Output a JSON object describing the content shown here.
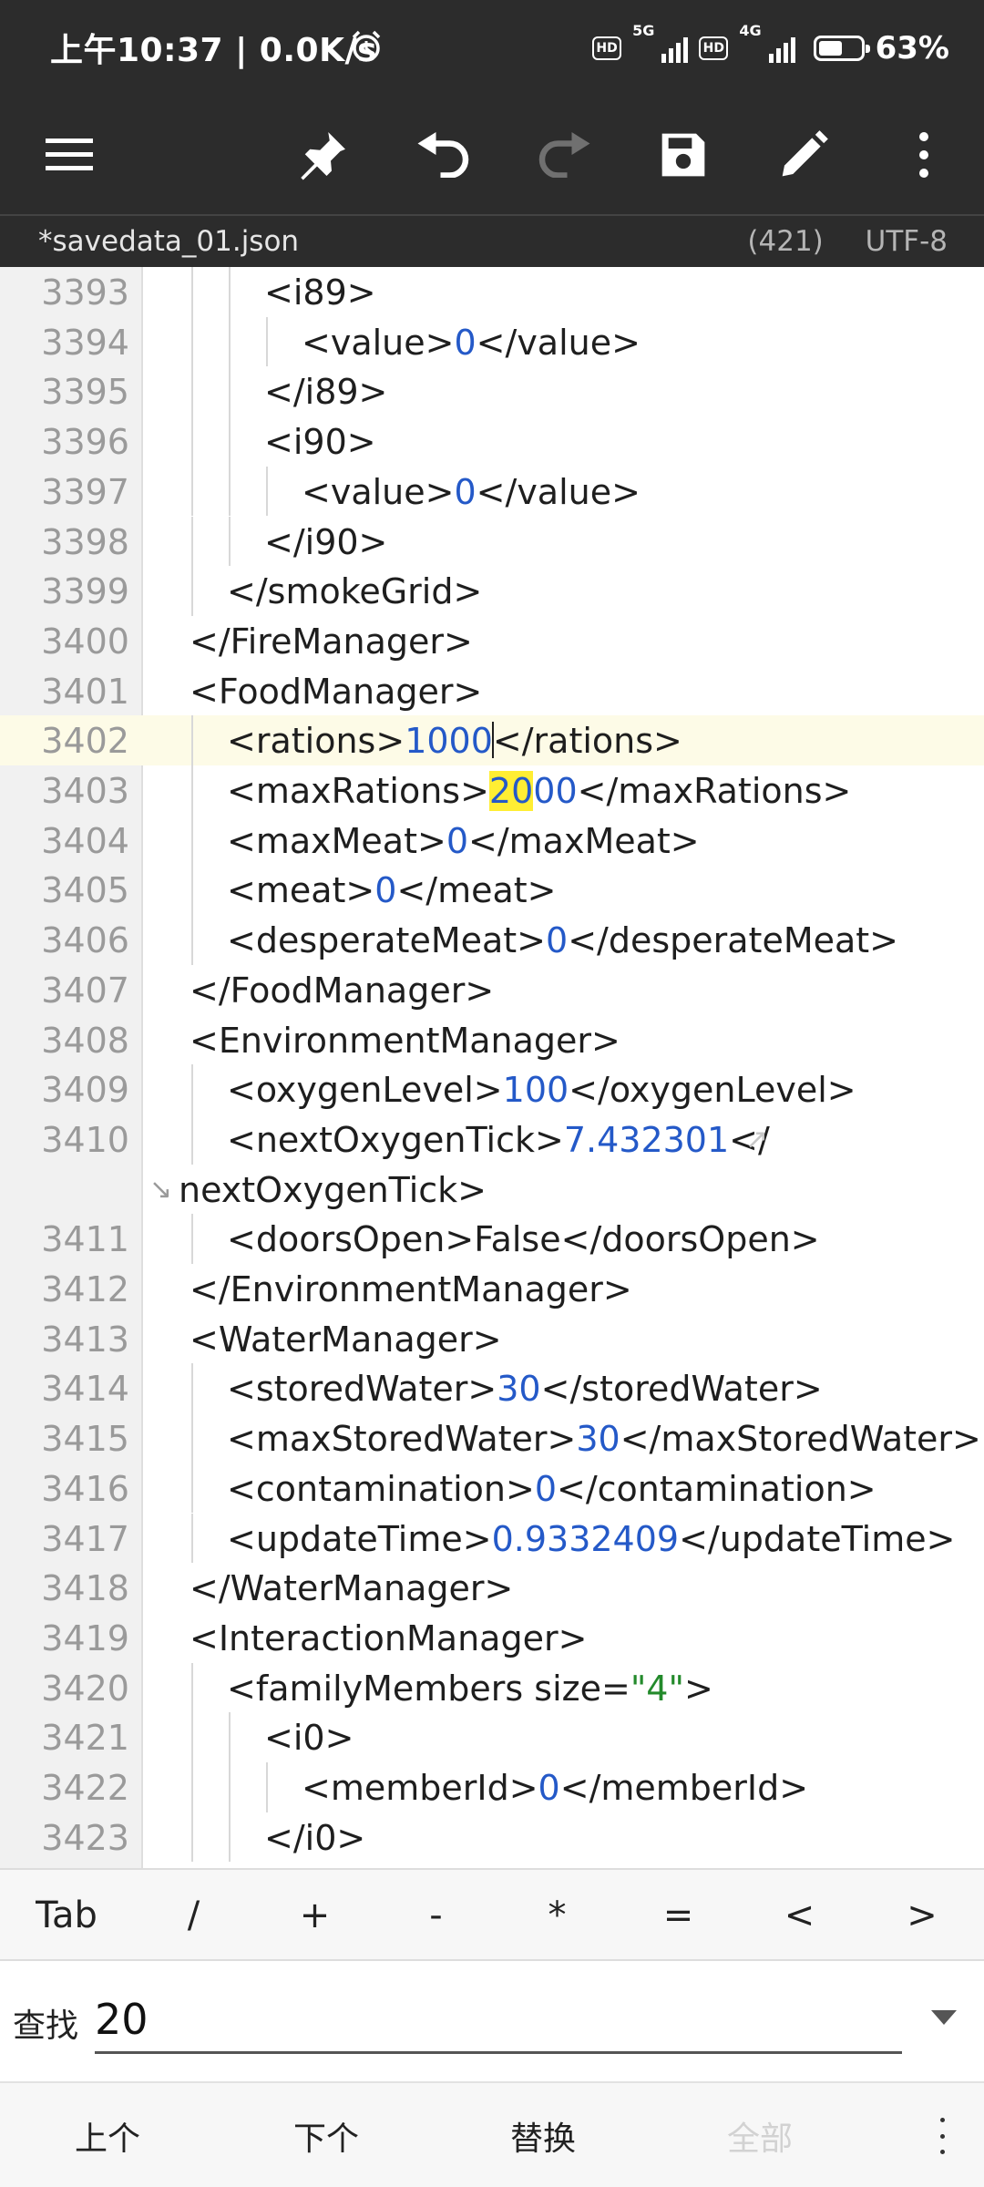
{
  "status_bar": {
    "time": "上午10:37 | 0.0K/s",
    "net1": "5G",
    "net2": "4G",
    "hd": "HD",
    "battery_level": 63,
    "battery_text": "63%"
  },
  "toolbar": {
    "buttons": [
      "menu-icon",
      "pin-icon",
      "undo-icon",
      "redo-icon",
      "save-icon",
      "edit-icon",
      "more-vert-icon"
    ],
    "redo_enabled": false
  },
  "file_bar": {
    "file_name": "*savedata_01.json",
    "cursor_col": "(421)",
    "encoding": "UTF-8"
  },
  "editor": {
    "current_line": 3402,
    "lines": [
      {
        "n": "3393",
        "indent": 3,
        "segs": [
          [
            "t",
            "<i89>"
          ]
        ]
      },
      {
        "n": "3394",
        "indent": 4,
        "segs": [
          [
            "t",
            "<value>"
          ],
          [
            "n",
            "0"
          ],
          [
            "t",
            "</value>"
          ]
        ]
      },
      {
        "n": "3395",
        "indent": 3,
        "segs": [
          [
            "t",
            "</i89>"
          ]
        ]
      },
      {
        "n": "3396",
        "indent": 3,
        "segs": [
          [
            "t",
            "<i90>"
          ]
        ]
      },
      {
        "n": "3397",
        "indent": 4,
        "segs": [
          [
            "t",
            "<value>"
          ],
          [
            "n",
            "0"
          ],
          [
            "t",
            "</value>"
          ]
        ]
      },
      {
        "n": "3398",
        "indent": 3,
        "segs": [
          [
            "t",
            "</i90>"
          ]
        ]
      },
      {
        "n": "3399",
        "indent": 2,
        "segs": [
          [
            "t",
            "</smokeGrid>"
          ]
        ]
      },
      {
        "n": "3400",
        "indent": 1,
        "segs": [
          [
            "t",
            "</FireManager>"
          ]
        ]
      },
      {
        "n": "3401",
        "indent": 1,
        "segs": [
          [
            "t",
            "<FoodManager>"
          ]
        ]
      },
      {
        "n": "3402",
        "indent": 2,
        "segs": [
          [
            "t",
            "<rations>"
          ],
          [
            "n",
            "1000"
          ],
          [
            "c",
            ""
          ],
          [
            "t",
            "</rations>"
          ]
        ]
      },
      {
        "n": "3403",
        "indent": 2,
        "segs": [
          [
            "t",
            "<maxRations>"
          ],
          [
            "h",
            "20"
          ],
          [
            "n",
            "00"
          ],
          [
            "t",
            "</maxRations>"
          ]
        ]
      },
      {
        "n": "3404",
        "indent": 2,
        "segs": [
          [
            "t",
            "<maxMeat>"
          ],
          [
            "n",
            "0"
          ],
          [
            "t",
            "</maxMeat>"
          ]
        ]
      },
      {
        "n": "3405",
        "indent": 2,
        "segs": [
          [
            "t",
            "<meat>"
          ],
          [
            "n",
            "0"
          ],
          [
            "t",
            "</meat>"
          ]
        ]
      },
      {
        "n": "3406",
        "indent": 2,
        "segs": [
          [
            "t",
            "<desperateMeat>"
          ],
          [
            "n",
            "0"
          ],
          [
            "t",
            "</desperateMeat>"
          ]
        ]
      },
      {
        "n": "3407",
        "indent": 1,
        "segs": [
          [
            "t",
            "</FoodManager>"
          ]
        ]
      },
      {
        "n": "3408",
        "indent": 1,
        "segs": [
          [
            "t",
            "<EnvironmentManager>"
          ]
        ]
      },
      {
        "n": "3409",
        "indent": 2,
        "segs": [
          [
            "t",
            "<oxygenLevel>"
          ],
          [
            "n",
            "100"
          ],
          [
            "t",
            "</oxygenLevel>"
          ]
        ]
      },
      {
        "n": "3410",
        "indent": 2,
        "segs": [
          [
            "t",
            "<nextOxygenTick>"
          ],
          [
            "n",
            "7.432301"
          ],
          [
            "t",
            "</"
          ]
        ],
        "wrapped": true
      },
      {
        "n": "",
        "indent": 0,
        "segs": [
          [
            "t",
            "nextOxygenTick>"
          ]
        ],
        "continuation": true
      },
      {
        "n": "3411",
        "indent": 2,
        "segs": [
          [
            "t",
            "<doorsOpen>False</doorsOpen>"
          ]
        ]
      },
      {
        "n": "3412",
        "indent": 1,
        "segs": [
          [
            "t",
            "</EnvironmentManager>"
          ]
        ]
      },
      {
        "n": "3413",
        "indent": 1,
        "segs": [
          [
            "t",
            "<WaterManager>"
          ]
        ]
      },
      {
        "n": "3414",
        "indent": 2,
        "segs": [
          [
            "t",
            "<storedWater>"
          ],
          [
            "n",
            "30"
          ],
          [
            "t",
            "</storedWater>"
          ]
        ]
      },
      {
        "n": "3415",
        "indent": 2,
        "segs": [
          [
            "t",
            "<maxStoredWater>"
          ],
          [
            "n",
            "30"
          ],
          [
            "t",
            "</maxStoredWater>"
          ]
        ]
      },
      {
        "n": "3416",
        "indent": 2,
        "segs": [
          [
            "t",
            "<contamination>"
          ],
          [
            "n",
            "0"
          ],
          [
            "t",
            "</contamination>"
          ]
        ]
      },
      {
        "n": "3417",
        "indent": 2,
        "segs": [
          [
            "t",
            "<updateTime>"
          ],
          [
            "n",
            "0.9332409"
          ],
          [
            "t",
            "</updateTime>"
          ]
        ]
      },
      {
        "n": "3418",
        "indent": 1,
        "segs": [
          [
            "t",
            "</WaterManager>"
          ]
        ]
      },
      {
        "n": "3419",
        "indent": 1,
        "segs": [
          [
            "t",
            "<InteractionManager>"
          ]
        ]
      },
      {
        "n": "3420",
        "indent": 2,
        "segs": [
          [
            "t",
            "<familyMembers size="
          ],
          [
            "s",
            "\"4\""
          ],
          [
            "t",
            ">"
          ]
        ]
      },
      {
        "n": "3421",
        "indent": 3,
        "segs": [
          [
            "t",
            "<i0>"
          ]
        ]
      },
      {
        "n": "3422",
        "indent": 4,
        "segs": [
          [
            "t",
            "<memberId>"
          ],
          [
            "n",
            "0"
          ],
          [
            "t",
            "</memberId>"
          ]
        ]
      },
      {
        "n": "3423",
        "indent": 3,
        "segs": [
          [
            "t",
            "</i0>"
          ]
        ]
      }
    ]
  },
  "symbol_bar": {
    "keys": [
      "Tab",
      "/",
      "+",
      "-",
      "*",
      "=",
      "<",
      ">"
    ]
  },
  "find_bar": {
    "label": "查找",
    "value": "20"
  },
  "action_bar": {
    "prev": "上个",
    "next": "下个",
    "replace": "替换",
    "all": "全部"
  }
}
